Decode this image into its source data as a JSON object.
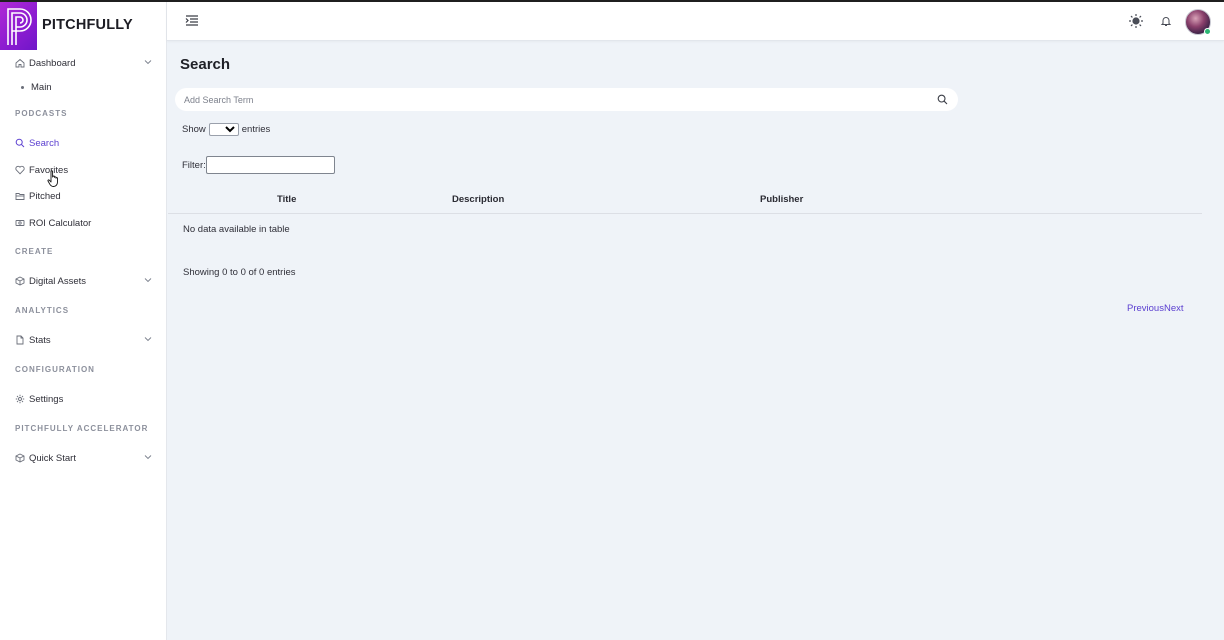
{
  "app": {
    "brand": "PITCHFULLY"
  },
  "sidebar": {
    "dashboard": "Dashboard",
    "dashboard_sub": "Main",
    "sections": {
      "podcasts": "PODCASTS",
      "create": "CREATE",
      "analytics": "ANALYTICS",
      "configuration": "CONFIGURATION",
      "accelerator": "PITCHFULLY ACCELERATOR"
    },
    "items": {
      "search": "Search",
      "favorites": "Favorites",
      "pitched": "Pitched",
      "roi": "ROI Calculator",
      "digital_assets": "Digital Assets",
      "stats": "Stats",
      "settings": "Settings",
      "quick_start": "Quick Start"
    },
    "active_item": "Search",
    "active_color": "#5b3fd0"
  },
  "main": {
    "title": "Search",
    "search_placeholder": "Add Search Term",
    "show_label": "Show",
    "entries_label": "entries",
    "filter_label": "Filter:",
    "table": {
      "columns": [
        "Title",
        "Description",
        "Publisher"
      ],
      "empty": "No data available in table"
    },
    "info": "Showing 0 to 0 of 0 entries",
    "pagination": {
      "previous": "Previous",
      "next": "Next"
    }
  }
}
